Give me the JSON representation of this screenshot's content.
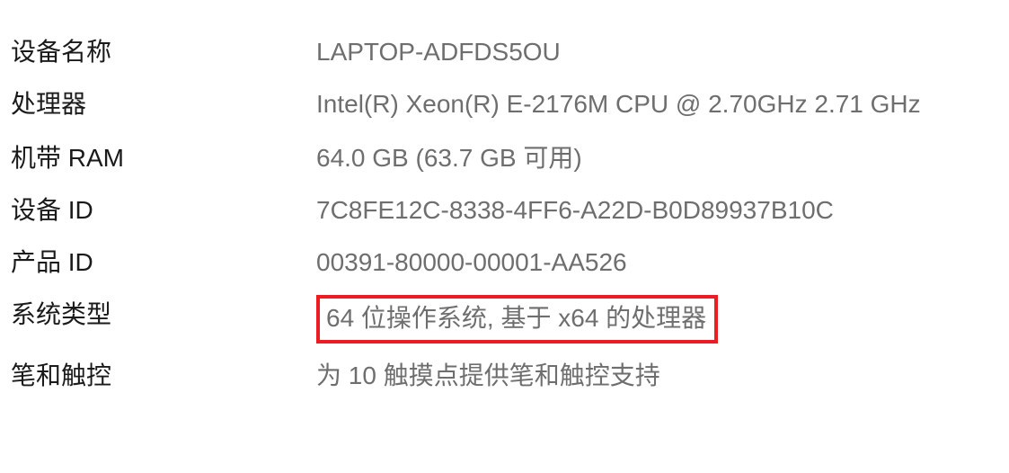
{
  "theme": {
    "background": "#ffffff",
    "label_color": "#1a1a1a",
    "value_color": "#6e6e6e",
    "highlight_border_color": "#ED1C24"
  },
  "device_specs": {
    "rows": [
      {
        "key": "device_name",
        "label": "设备名称",
        "value": "LAPTOP-ADFDS5OU",
        "highlighted": false
      },
      {
        "key": "processor",
        "label": "处理器",
        "value": "Intel(R) Xeon(R) E-2176M  CPU @ 2.70GHz   2.71 GHz",
        "highlighted": false
      },
      {
        "key": "installed_ram",
        "label": "机带 RAM",
        "value": "64.0 GB (63.7 GB 可用)",
        "highlighted": false
      },
      {
        "key": "device_id",
        "label": "设备 ID",
        "value": "7C8FE12C-8338-4FF6-A22D-B0D89937B10C",
        "highlighted": false
      },
      {
        "key": "product_id",
        "label": "产品 ID",
        "value": "00391-80000-00001-AA526",
        "highlighted": false
      },
      {
        "key": "system_type",
        "label": "系统类型",
        "value": "64 位操作系统, 基于 x64 的处理器",
        "highlighted": true
      },
      {
        "key": "pen_and_touch",
        "label": "笔和触控",
        "value": "为 10 触摸点提供笔和触控支持",
        "highlighted": false
      }
    ]
  }
}
